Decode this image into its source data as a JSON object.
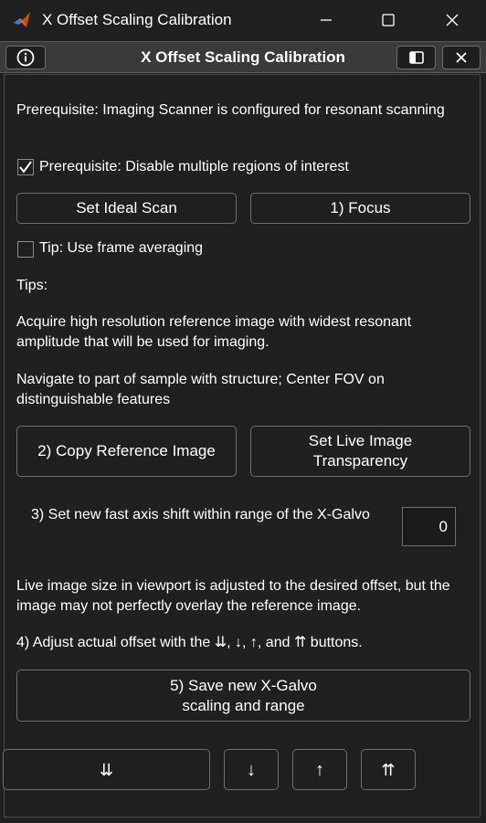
{
  "window": {
    "title": "X Offset Scaling Calibration",
    "app_icon": "matlab-icon",
    "controls": [
      "minimize-icon",
      "maximize-icon",
      "close-icon"
    ]
  },
  "header": {
    "title": "X Offset Scaling Calibration",
    "info_icon": "info-icon",
    "dock_icon": "dock-icon",
    "close_icon": "close-icon"
  },
  "content": {
    "prereq_text": "Prerequisite: Imaging Scanner is configured for resonant scanning",
    "checkbox_prereq": {
      "label": "Prerequisite: Disable multiple regions of interest",
      "checked": true
    },
    "btn_set_ideal_scan": "Set Ideal Scan",
    "btn_focus": "1) Focus",
    "checkbox_tip": {
      "label": "Tip: Use frame averaging",
      "checked": false
    },
    "tips_heading": "Tips:",
    "tip1": "Acquire high resolution reference image with widest resonant amplitude that will be used for imaging.",
    "tip2": "Navigate to part of sample with structure; Center FOV on distinguishable features",
    "btn_copy_reference": "2) Copy Reference Image",
    "btn_set_transparency": "Set Live Image Transparency",
    "shift_label": "3) Set new fast axis shift within range of the X-Galvo",
    "shift_value": "0",
    "live_image_note": "Live image size in viewport is adjusted to the desired offset, but the image may not perfectly overlay the reference image.",
    "adjust_note": "4) Adjust actual offset with the ⇊, ↓, ↑, and ⇈ buttons.",
    "btn_save": "5) Save new X-Galvo scaling and range",
    "btn_down_double": "⇊",
    "btn_down": "↓",
    "btn_up": "↑",
    "btn_up_double": "⇈"
  },
  "colors": {
    "background": "#202020",
    "header_bar": "#3a3a3a",
    "border": "#6e6e6e",
    "text": "#ffffff"
  }
}
